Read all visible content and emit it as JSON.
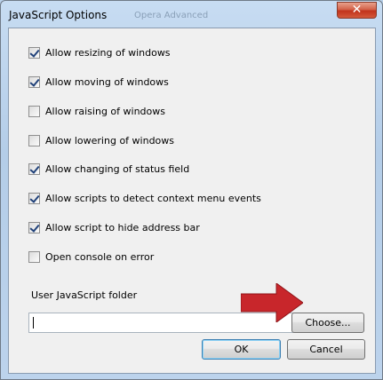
{
  "dialog": {
    "title": "JavaScript Options",
    "background_tab_text": "Opera  Advanced",
    "close_glyph": "✕"
  },
  "options": [
    {
      "label": "Allow resizing of windows",
      "checked": true
    },
    {
      "label": "Allow moving of windows",
      "checked": true
    },
    {
      "label": "Allow raising of windows",
      "checked": false
    },
    {
      "label": "Allow lowering of windows",
      "checked": false
    },
    {
      "label": "Allow changing of status field",
      "checked": true
    },
    {
      "label": "Allow scripts to detect context menu events",
      "checked": true
    },
    {
      "label": "Allow script to hide address bar",
      "checked": true
    },
    {
      "label": "Open console on error",
      "checked": false
    }
  ],
  "folder": {
    "label": "User JavaScript folder",
    "value": "",
    "choose_label": "Choose..."
  },
  "buttons": {
    "ok_label": "OK",
    "cancel_label": "Cancel"
  },
  "colors": {
    "arrow": "#c8262b",
    "close_button": "#c2331c",
    "checkmark": "#21427a"
  },
  "icons": {
    "close": "close-icon",
    "arrow": "red-arrow-annotation"
  }
}
